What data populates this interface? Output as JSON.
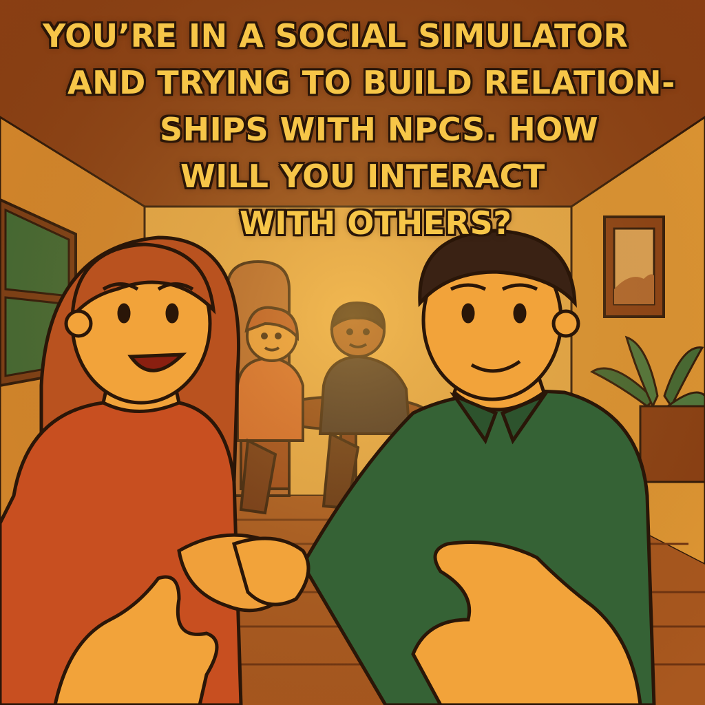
{
  "caption": {
    "lines": [
      "YOU’RE IN A SOCIAL SIMULATOR",
      "AND TRYING TO BUILD RELATION-",
      "SHIPS WITH NPCs. HOW",
      "WILL YOU INTERACT",
      "WITH OTHERS?"
    ]
  },
  "scene": {
    "palette": {
      "wall": "#e9a63c",
      "ceiling": "#8a3f13",
      "floor": "#a9581f",
      "outline": "#2a1608",
      "npc_woman_shirt": "#c84f20",
      "npc_man_shirt": "#356235",
      "skin": "#f2a33a",
      "text": "#f7c648"
    },
    "characters": [
      "npc-woman-smiling",
      "npc-man-handshake",
      "npc-seated-woman",
      "npc-seated-man"
    ]
  }
}
